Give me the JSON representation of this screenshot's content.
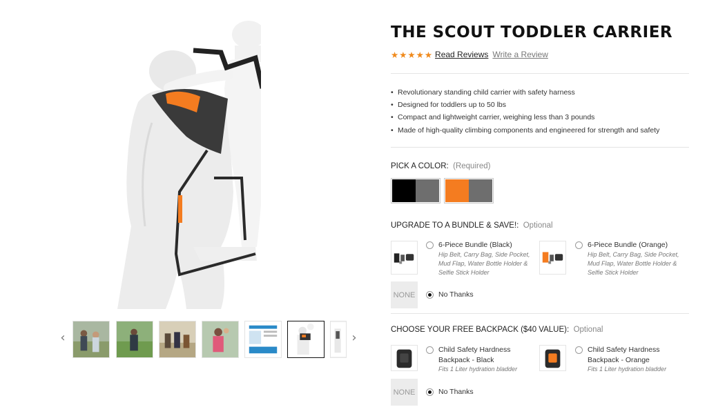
{
  "product": {
    "title": "THE SCOUT TODDLER CARRIER",
    "rating_stars": "★★★★★",
    "read_reviews": "Read Reviews",
    "write_review": "Write a Review",
    "features": [
      "Revolutionary standing child carrier with safety harness",
      "Designed for toddlers up to 50 lbs",
      "Compact and lightweight carrier, weighing less than 3 pounds",
      "Made of high-quality climbing components and engineered for strength and safety"
    ]
  },
  "colors": {
    "label": "PICK A COLOR:",
    "note": "(Required)",
    "swatches": [
      {
        "name": "Black",
        "left": "#000000",
        "right": "#6e6e6e"
      },
      {
        "name": "Orange",
        "left": "#f47c20",
        "right": "#6e6e6e"
      }
    ]
  },
  "bundle": {
    "label": "UPGRADE TO A BUNDLE & SAVE!:",
    "note": "Optional",
    "options": [
      {
        "name": "6-Piece Bundle (Black)",
        "desc": "Hip Belt, Carry Bag, Side Pocket, Mud Flap, Water Bottle Holder & Selfie Stick Holder"
      },
      {
        "name": "6-Piece Bundle (Orange)",
        "desc": "Hip Belt, Carry Bag, Side Pocket, Mud Flap, Water Bottle Holder & Selfie Stick Holder"
      }
    ],
    "none_label": "NONE",
    "no_thanks": "No Thanks"
  },
  "backpack": {
    "label": "CHOOSE YOUR FREE BACKPACK ($40 VALUE):",
    "note": "Optional",
    "options": [
      {
        "name_line1": "Child Safety Hardness",
        "name_line2": "Backpack - Black",
        "desc": "Fits 1 Liter hydration bladder"
      },
      {
        "name_line1": "Child Safety Hardness",
        "name_line2": "Backpack - Orange",
        "desc": "Fits 1 Liter hydration bladder"
      }
    ],
    "none_label": "NONE",
    "no_thanks": "No Thanks"
  },
  "gallery": {
    "prev_icon": "‹",
    "next_icon": "›",
    "active_thumb": 5,
    "thumb_count": 7
  }
}
